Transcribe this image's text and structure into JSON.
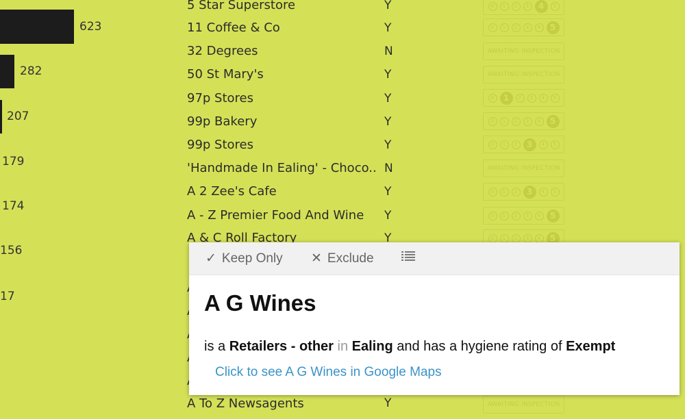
{
  "bar_values": [
    "623",
    "282",
    "207",
    "179",
    "174",
    "156",
    "17"
  ],
  "rows": [
    {
      "name": "5 Star Superstore",
      "flag": "Y",
      "rating": "4"
    },
    {
      "name": "11 Coffee & Co",
      "flag": "Y",
      "rating": "5"
    },
    {
      "name": "32 Degrees",
      "flag": "N",
      "rating": "AWAITING INSPECTION"
    },
    {
      "name": "50 St Mary's",
      "flag": "Y",
      "rating": "AWAITING INSPECTION"
    },
    {
      "name": "97p Stores",
      "flag": "Y",
      "rating": "1"
    },
    {
      "name": "99p Bakery",
      "flag": "Y",
      "rating": "5"
    },
    {
      "name": "99p Stores",
      "flag": "Y",
      "rating": "3"
    },
    {
      "name": "'Handmade In Ealing' - Choco..",
      "flag": "N",
      "rating": "AWAITING INSPECTION"
    },
    {
      "name": "A 2 Zee's Cafe",
      "flag": "Y",
      "rating": "3"
    },
    {
      "name": "A - Z Premier Food And Wine",
      "flag": "Y",
      "rating": "5"
    },
    {
      "name": "A & C Roll Factory",
      "flag": "Y",
      "rating": "5"
    }
  ],
  "bottom_row": {
    "name": "A To Z Newsagents",
    "flag": "Y",
    "rating": "AWAITING INSPECTION"
  },
  "tooltip": {
    "keep_only": "Keep Only",
    "exclude": "Exclude",
    "title": "A G Wines",
    "desc_prefix": "is a",
    "business_type": "Retailers - other",
    "desc_in": "in",
    "location": "Ealing",
    "desc_mid": "and has a hygiene rating of",
    "rating": "Exempt",
    "link": "Click to see A G Wines in Google Maps"
  },
  "colors": {
    "background": "#d4e157",
    "bar": "#1c1c1c",
    "link": "#3b93c8"
  }
}
